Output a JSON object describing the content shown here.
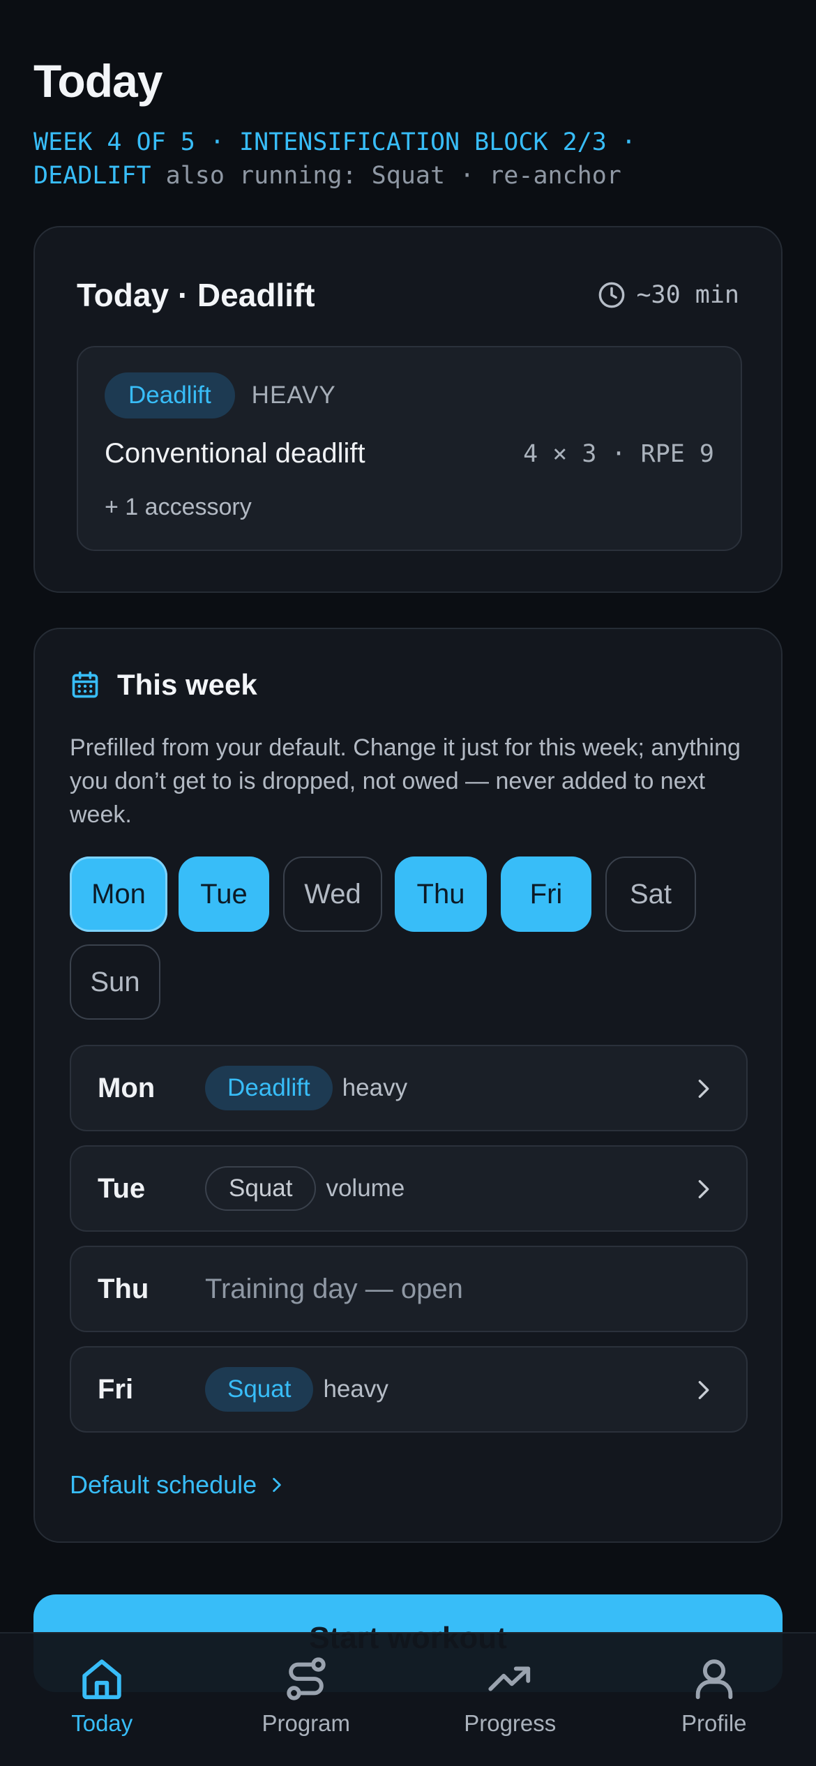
{
  "header": {
    "title": "Today",
    "block_line": "WEEK 4 OF 5 · INTENSIFICATION BLOCK 2/3 ·",
    "lift": "DEADLIFT",
    "also_running": "also running: Squat · re-anchor"
  },
  "today_card": {
    "title": "Today · Deadlift",
    "duration": "~30 min",
    "icon": "clock-icon",
    "session": {
      "lift_tag": "Deadlift",
      "intensity": "HEAVY",
      "exercise": "Conventional deadlift",
      "scheme": "4 × 3 · RPE 9",
      "accessory": "+ 1 accessory"
    }
  },
  "week_card": {
    "title": "This week",
    "icon": "calendar-icon",
    "description": "Prefilled from your default. Change it just for this week; anything you don’t get to is dropped, not owed — never added to next week.",
    "days": [
      {
        "label": "Mon",
        "selected": true
      },
      {
        "label": "Tue",
        "selected": true
      },
      {
        "label": "Wed",
        "selected": false
      },
      {
        "label": "Thu",
        "selected": true
      },
      {
        "label": "Fri",
        "selected": true
      },
      {
        "label": "Sat",
        "selected": false
      },
      {
        "label": "Sun",
        "selected": false
      }
    ],
    "schedule": [
      {
        "day": "Mon",
        "lift": "Deadlift",
        "kind": "heavy"
      },
      {
        "day": "Tue",
        "lift": "Squat",
        "kind": "volume"
      },
      {
        "day": "Thu",
        "open_text": "Training day — open"
      },
      {
        "day": "Fri",
        "lift": "Squat",
        "kind": "heavy"
      }
    ],
    "default_link": "Default schedule"
  },
  "start_button": "Start workout",
  "nav": [
    {
      "label": "Today",
      "icon": "home-icon",
      "active": true
    },
    {
      "label": "Program",
      "icon": "program-icon",
      "active": false
    },
    {
      "label": "Progress",
      "icon": "trending-up-icon",
      "active": false
    },
    {
      "label": "Profile",
      "icon": "user-icon",
      "active": false
    }
  ],
  "colors": {
    "accent": "#38bdf8",
    "background": "#0b0e13",
    "card": "#13171e"
  }
}
